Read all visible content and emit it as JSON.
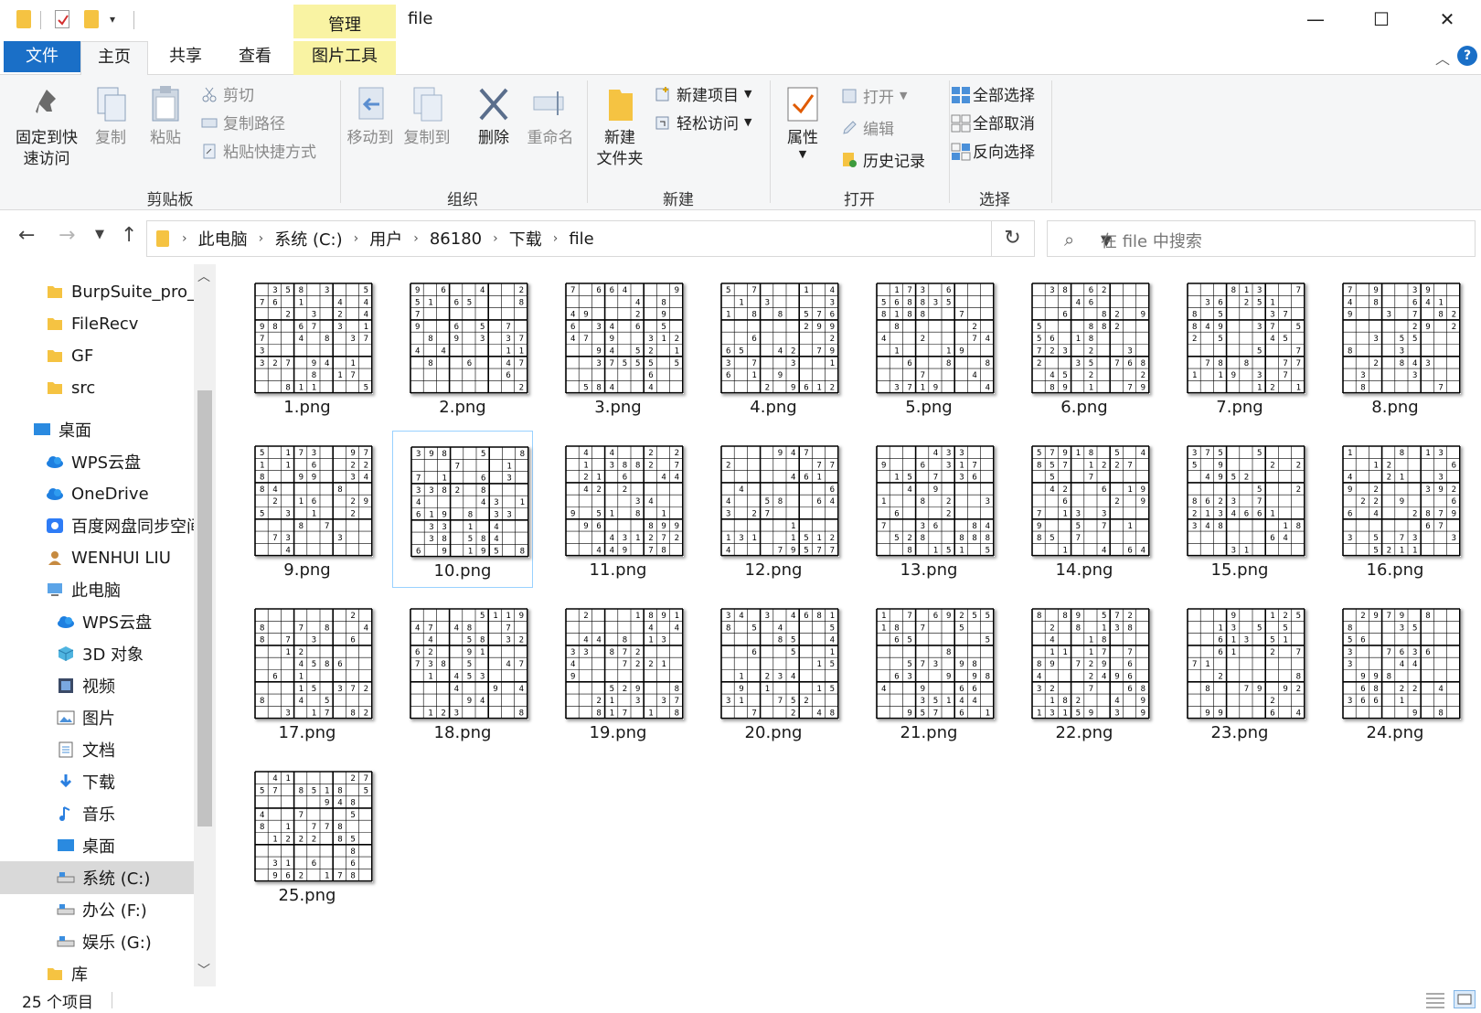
{
  "window": {
    "title": "file",
    "context_tab": "管理",
    "controls": {
      "minimize": "—",
      "maximize": "☐",
      "close": "✕"
    }
  },
  "ribbon_tabs": {
    "file": "文件",
    "home": "主页",
    "share": "共享",
    "view": "查看",
    "picture_tools": "图片工具"
  },
  "ribbon": {
    "clipboard": {
      "label": "剪贴板",
      "pin": "固定到快\n速访问",
      "copy": "复制",
      "paste": "粘贴",
      "cut": "剪切",
      "copy_path": "复制路径",
      "paste_shortcut": "粘贴快捷方式"
    },
    "organize": {
      "label": "组织",
      "move_to": "移动到",
      "copy_to": "复制到",
      "delete": "删除",
      "rename": "重命名"
    },
    "new": {
      "label": "新建",
      "new_folder": "新建\n文件夹",
      "new_item": "新建项目",
      "easy_access": "轻松访问"
    },
    "open": {
      "label": "打开",
      "properties": "属性",
      "open": "打开",
      "edit": "编辑",
      "history": "历史记录"
    },
    "select": {
      "label": "选择",
      "select_all": "全部选择",
      "select_none": "全部取消",
      "invert": "反向选择"
    }
  },
  "address": {
    "crumbs": [
      "此电脑",
      "系统 (C:)",
      "用户",
      "86180",
      "下载",
      "file"
    ],
    "search_placeholder": "在 file 中搜索"
  },
  "sidebar": {
    "items": [
      {
        "label": "BurpSuite_pro_",
        "icon": "folder-icon"
      },
      {
        "label": "FileRecv",
        "icon": "folder-icon"
      },
      {
        "label": "GF",
        "icon": "folder-icon"
      },
      {
        "label": "src",
        "icon": "folder-icon"
      },
      {
        "label": "桌面",
        "icon": "desktop-icon"
      },
      {
        "label": "WPS云盘",
        "icon": "cloud-icon"
      },
      {
        "label": "OneDrive",
        "icon": "cloud-icon"
      },
      {
        "label": "百度网盘同步空间",
        "icon": "baidu-icon"
      },
      {
        "label": "WENHUI LIU",
        "icon": "user-icon"
      },
      {
        "label": "此电脑",
        "icon": "computer-icon"
      },
      {
        "label": "WPS云盘",
        "icon": "cloud-icon"
      },
      {
        "label": "3D 对象",
        "icon": "cube-icon"
      },
      {
        "label": "视频",
        "icon": "video-icon"
      },
      {
        "label": "图片",
        "icon": "pictures-icon"
      },
      {
        "label": "文档",
        "icon": "document-icon"
      },
      {
        "label": "下载",
        "icon": "download-icon"
      },
      {
        "label": "音乐",
        "icon": "music-icon"
      },
      {
        "label": "桌面",
        "icon": "desktop-icon"
      },
      {
        "label": "系统 (C:)",
        "icon": "drive-icon"
      },
      {
        "label": "办公 (F:)",
        "icon": "drive-icon"
      },
      {
        "label": "娱乐 (G:)",
        "icon": "drive-icon"
      },
      {
        "label": "库",
        "icon": "folder-icon"
      }
    ],
    "selected_index": 18
  },
  "files": [
    "1.png",
    "2.png",
    "3.png",
    "4.png",
    "5.png",
    "6.png",
    "7.png",
    "8.png",
    "9.png",
    "10.png",
    "11.png",
    "12.png",
    "13.png",
    "14.png",
    "15.png",
    "16.png",
    "17.png",
    "18.png",
    "19.png",
    "20.png",
    "21.png",
    "22.png",
    "23.png",
    "24.png",
    "25.png"
  ],
  "selected_file_index": 9,
  "status": {
    "count": "25 个项目"
  },
  "colors": {
    "accent": "#1a6fc7",
    "context_tab": "#f9f3a3",
    "selection": "#99d1ff",
    "folder": "#f5c342"
  }
}
